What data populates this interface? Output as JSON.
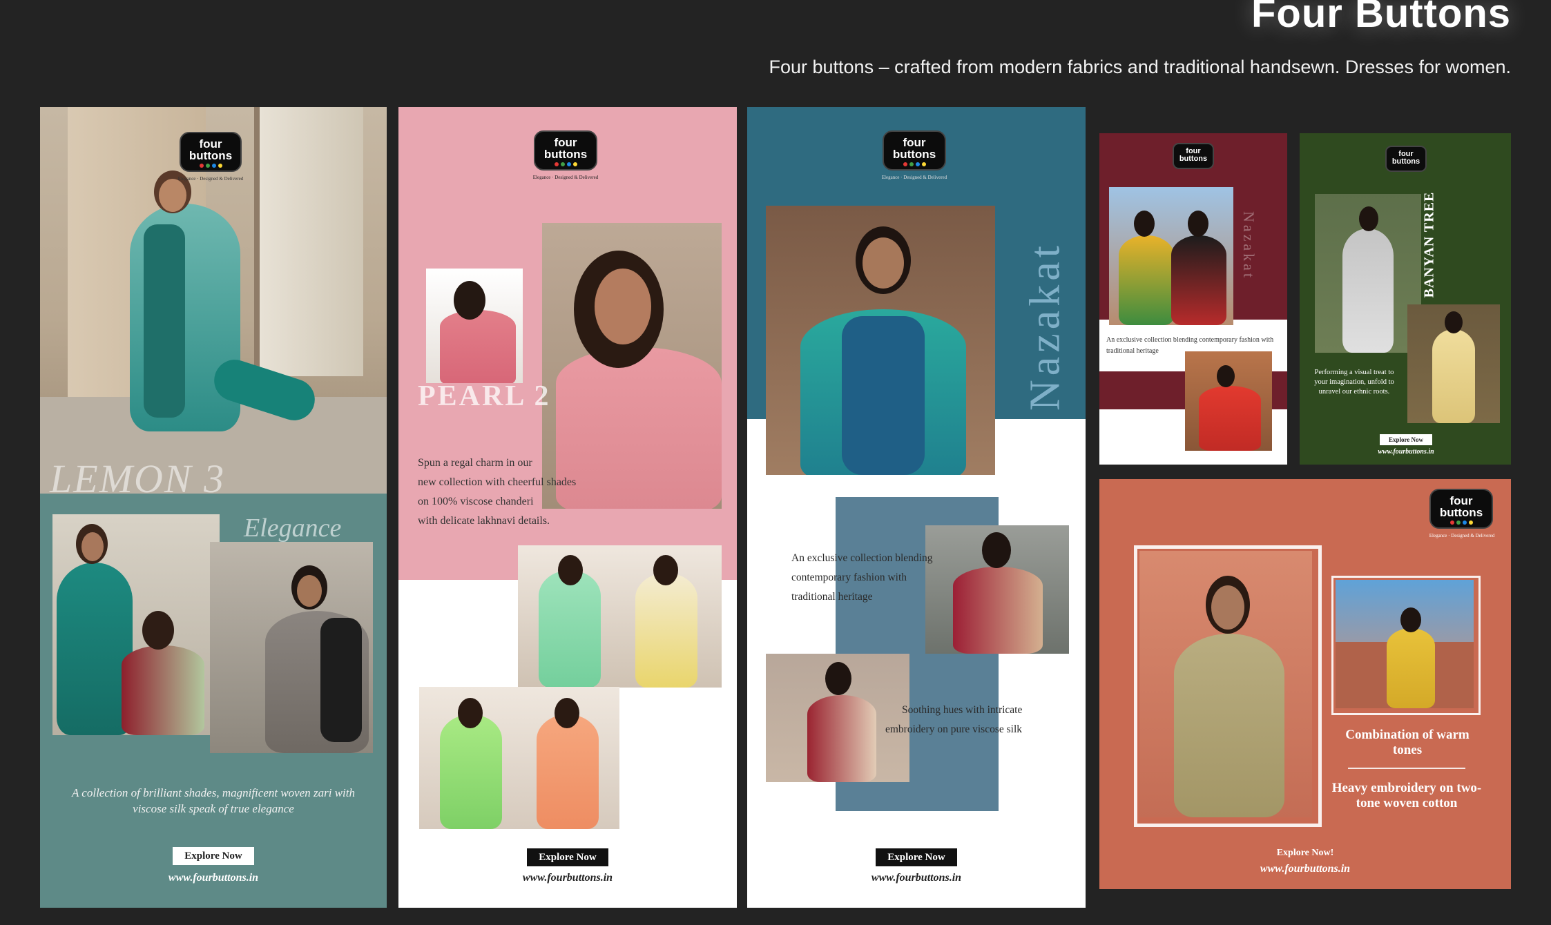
{
  "header": {
    "title": "Four Buttons",
    "subtitle": "Four buttons – crafted from modern fabrics and traditional handsewn. Dresses for women."
  },
  "brand": {
    "logo_line1": "four",
    "logo_line2": "buttons",
    "tagline": "Elegance · Designed & Delivered",
    "dot_colors": [
      "#e53935",
      "#43a047",
      "#1e88e5",
      "#fdd835"
    ]
  },
  "cards": {
    "lemon": {
      "title": "LEMON 3",
      "subtitle": "Elegance",
      "description": "A collection of brilliant shades, magnificent woven zari with viscose silk speak of true elegance",
      "cta": "Explore Now",
      "url": "www.fourbuttons.in",
      "bg_color": "#5e8a87"
    },
    "pearl": {
      "title": "PEARL 2",
      "description_lines": [
        "Spun a regal charm in our",
        "new collection with cheerful shades",
        "on 100% viscose chanderi",
        "with delicate lakhnavi details."
      ],
      "cta": "Explore Now",
      "url": "www.fourbuttons.in",
      "bg_color": "#e8a7b1"
    },
    "nazakat": {
      "title": "Nazakat",
      "description_lines": [
        "An exclusive collection blending",
        "contemporary fashion with",
        "traditional heritage"
      ],
      "description2_lines": [
        "Soothing hues with intricate",
        "embroidery on pure viscose silk"
      ],
      "cta": "Explore Now",
      "url": "www.fourbuttons.in",
      "bg_color": "#2f6b80"
    },
    "maroon": {
      "title": "Nazakat",
      "description": "An exclusive collection blending contemporary fashion with traditional heritage",
      "bg_color": "#6e1f2b"
    },
    "banyan": {
      "title": "BANYAN TREE",
      "description": "Performing a visual treat to your imagination, unfold to unravel our ethnic roots.",
      "cta": "Explore Now",
      "url": "www.fourbuttons.in",
      "bg_color": "#2f4a1f"
    },
    "terracotta": {
      "heading1": "Combination of warm tones",
      "heading2": "Heavy embroidery on two-tone woven cotton",
      "cta": "Explore Now!",
      "url": "www.fourbuttons.in",
      "bg_color": "#c96a52"
    }
  }
}
